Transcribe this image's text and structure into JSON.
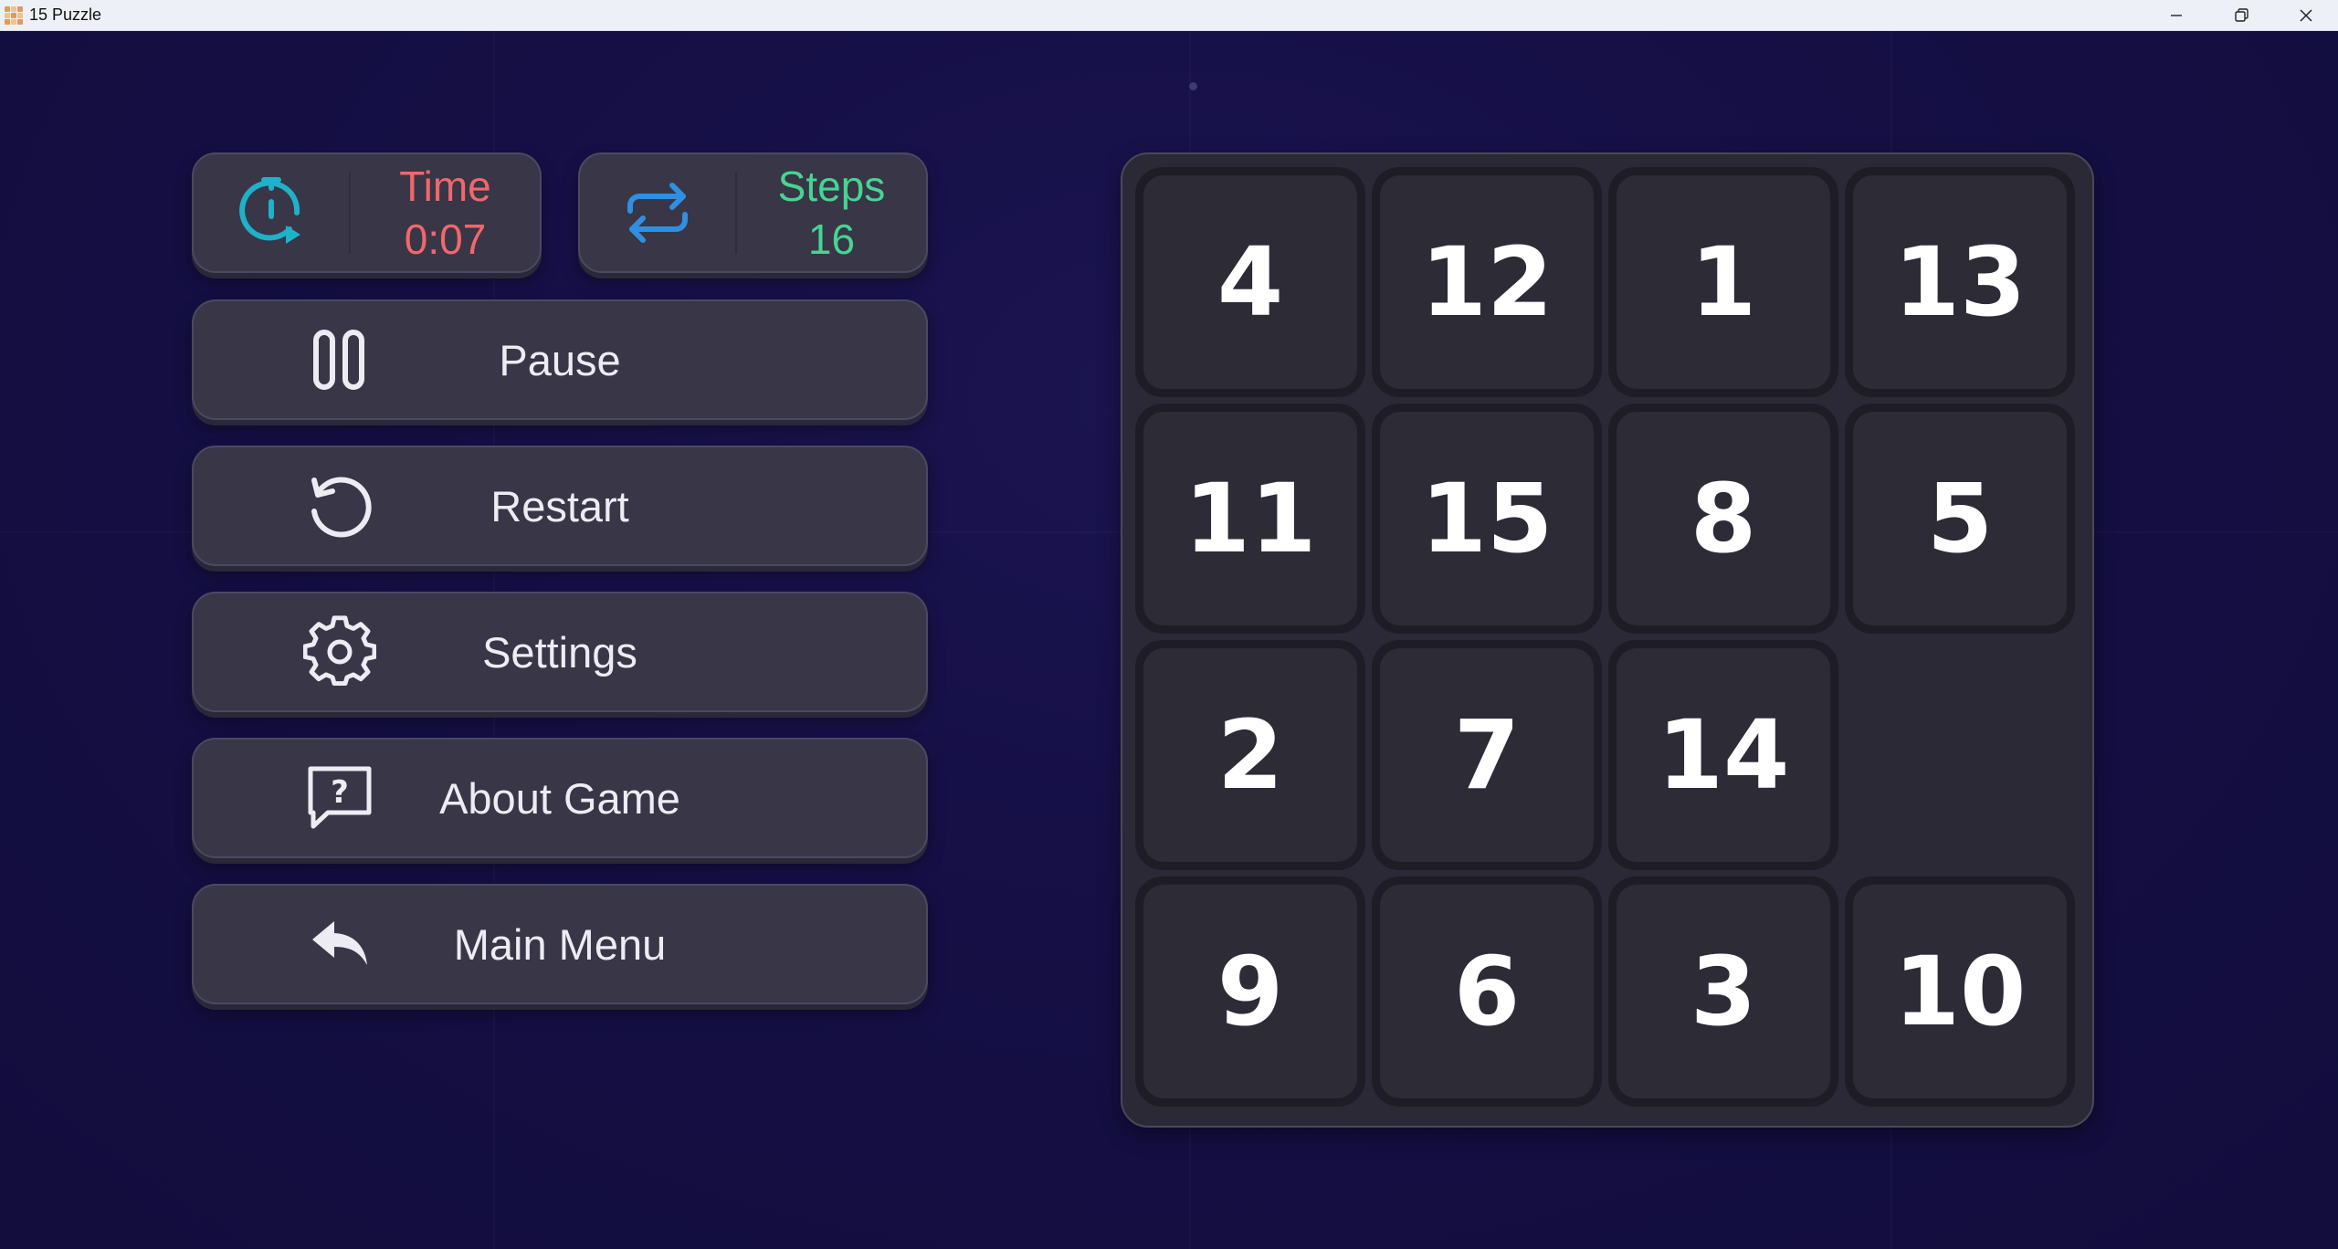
{
  "window": {
    "title": "15 Puzzle"
  },
  "stats": {
    "time_label": "Time",
    "time_value": "0:07",
    "time_color": "#f0686a",
    "time_icon_color": "#1fb1c9",
    "steps_label": "Steps",
    "steps_value": "16",
    "steps_color": "#46d590",
    "steps_icon_color": "#2f8fe0"
  },
  "menu": [
    {
      "label": "Pause",
      "icon": "pause-icon"
    },
    {
      "label": "Restart",
      "icon": "restart-icon"
    },
    {
      "label": "Settings",
      "icon": "gear-icon"
    },
    {
      "label": "About Game",
      "icon": "help-chat-icon"
    },
    {
      "label": "Main Menu",
      "icon": "back-arrow-icon"
    }
  ],
  "board": {
    "tiles": [
      "4",
      "12",
      "1",
      "13",
      "11",
      "15",
      "8",
      "5",
      "2",
      "7",
      "14",
      "",
      "9",
      "6",
      "3",
      "10"
    ],
    "empty_index": 11
  }
}
